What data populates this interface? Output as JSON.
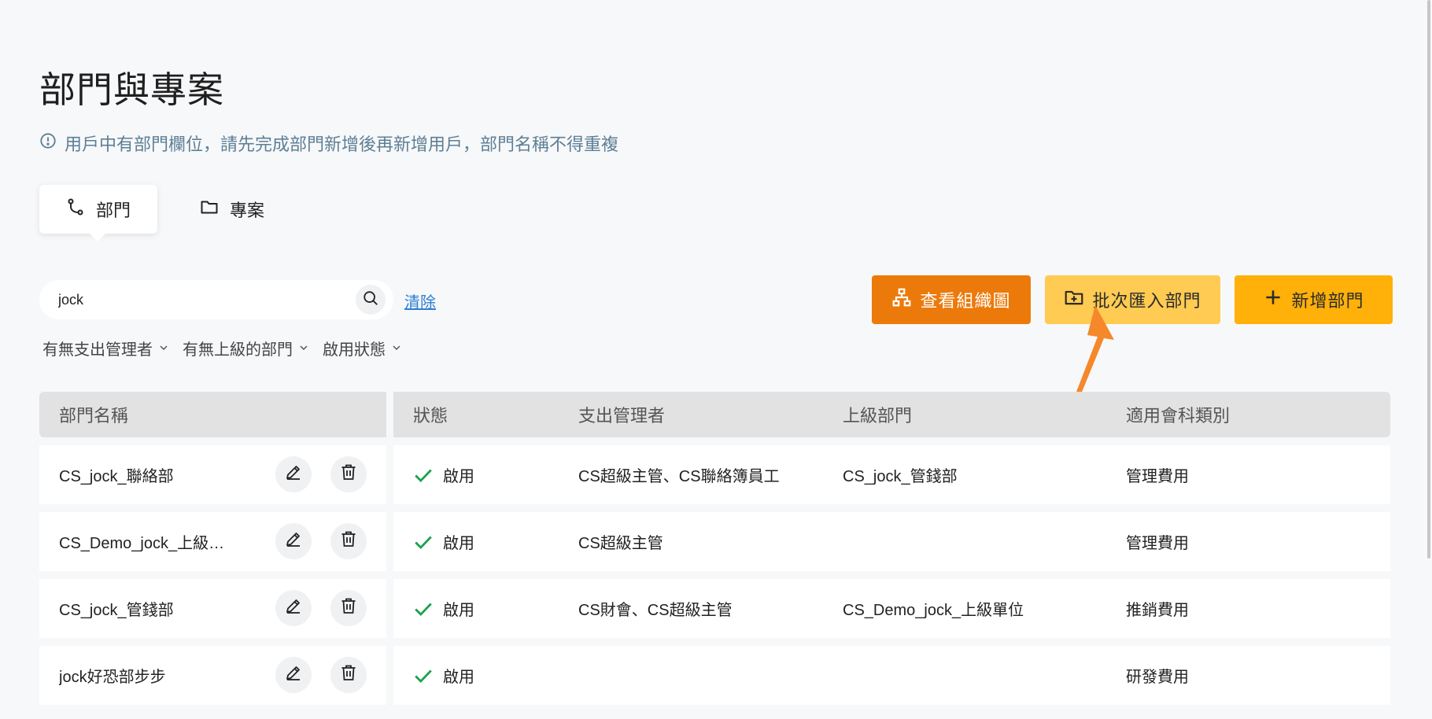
{
  "page": {
    "title": "部門與專案",
    "notice": "用戶中有部門欄位，請先完成部門新增後再新增用戶，部門名稱不得重複"
  },
  "tabs": [
    {
      "label": "部門",
      "icon": "branch-icon",
      "active": true
    },
    {
      "label": "專案",
      "icon": "folder-icon",
      "active": false
    }
  ],
  "search": {
    "value": "jock",
    "clear_label": "清除"
  },
  "filters": [
    "有無支出管理者",
    "有無上級的部門",
    "啟用狀態"
  ],
  "actions": {
    "org_chart": "查看組織圖",
    "batch_import": "批次匯入部門",
    "add_department": "新增部門"
  },
  "colors": {
    "org_chart": "#ec7a0b",
    "batch_import": "#ffcb52",
    "add_department": "#ffb10a",
    "status_check": "#1aa34a",
    "notice": "#5d7f95",
    "link": "#2d7fd3",
    "annotation_arrow": "#f5882a"
  },
  "table": {
    "headers": [
      "部門名稱",
      "狀態",
      "支出管理者",
      "上級部門",
      "適用會科類別"
    ],
    "rows": [
      {
        "name": "CS_jock_聯絡部",
        "status": "啟用",
        "manager": "CS超級主管、CS聯絡簿員工",
        "parent": "CS_jock_管錢部",
        "category": "管理費用"
      },
      {
        "name": "CS_Demo_jock_上級單...",
        "status": "啟用",
        "manager": "CS超級主管",
        "parent": "",
        "category": "管理費用"
      },
      {
        "name": "CS_jock_管錢部",
        "status": "啟用",
        "manager": "CS財會、CS超級主管",
        "parent": "CS_Demo_jock_上級單位",
        "category": "推銷費用"
      },
      {
        "name": "jock好恐部步步",
        "status": "啟用",
        "manager": "",
        "parent": "",
        "category": "研發費用"
      }
    ]
  }
}
